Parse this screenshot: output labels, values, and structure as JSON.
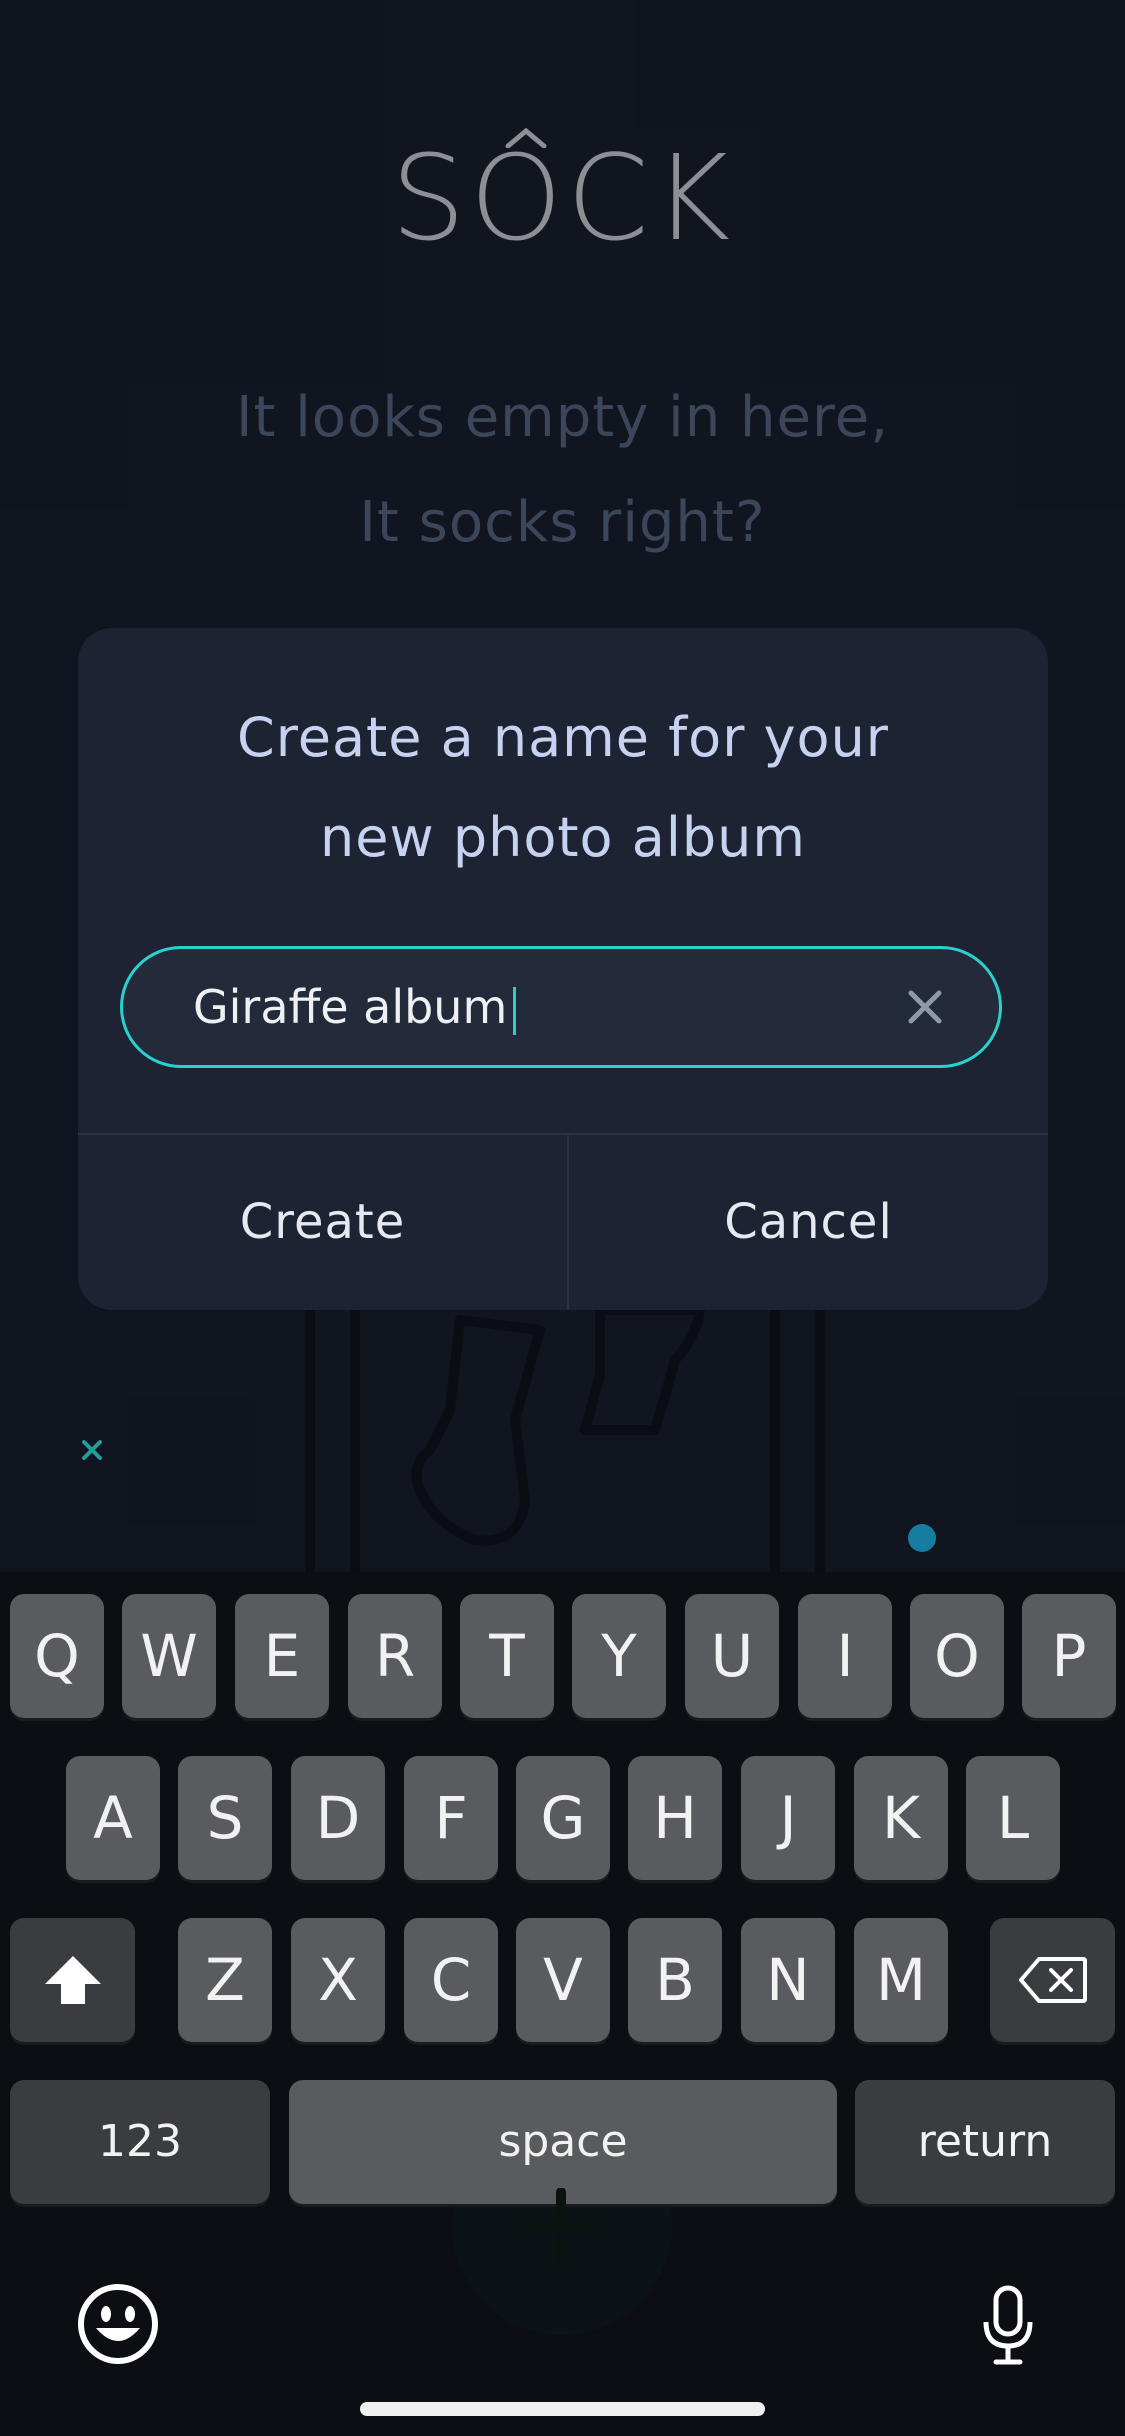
{
  "app": {
    "logo": "SOCK",
    "empty_line_1": "It looks empty in here,",
    "empty_line_2": "It socks right?"
  },
  "dialog": {
    "title_line_1": "Create a name for your",
    "title_line_2": "new photo album",
    "input_value": "Giraffe album",
    "create_label": "Create",
    "cancel_label": "Cancel"
  },
  "keyboard": {
    "row1": [
      "Q",
      "W",
      "E",
      "R",
      "T",
      "Y",
      "U",
      "I",
      "O",
      "P"
    ],
    "row2": [
      "A",
      "S",
      "D",
      "F",
      "G",
      "H",
      "J",
      "K",
      "L"
    ],
    "row3": [
      "Z",
      "X",
      "C",
      "V",
      "B",
      "N",
      "M"
    ],
    "numbers_label": "123",
    "space_label": "space",
    "return_label": "return",
    "icons": [
      "shift-icon",
      "backspace-icon",
      "emoji-icon",
      "microphone-icon"
    ]
  },
  "colors": {
    "background": "#131824",
    "dialog": "#1d2332",
    "accent": "#2ad1cc",
    "muted_text": "#4d5a73"
  }
}
